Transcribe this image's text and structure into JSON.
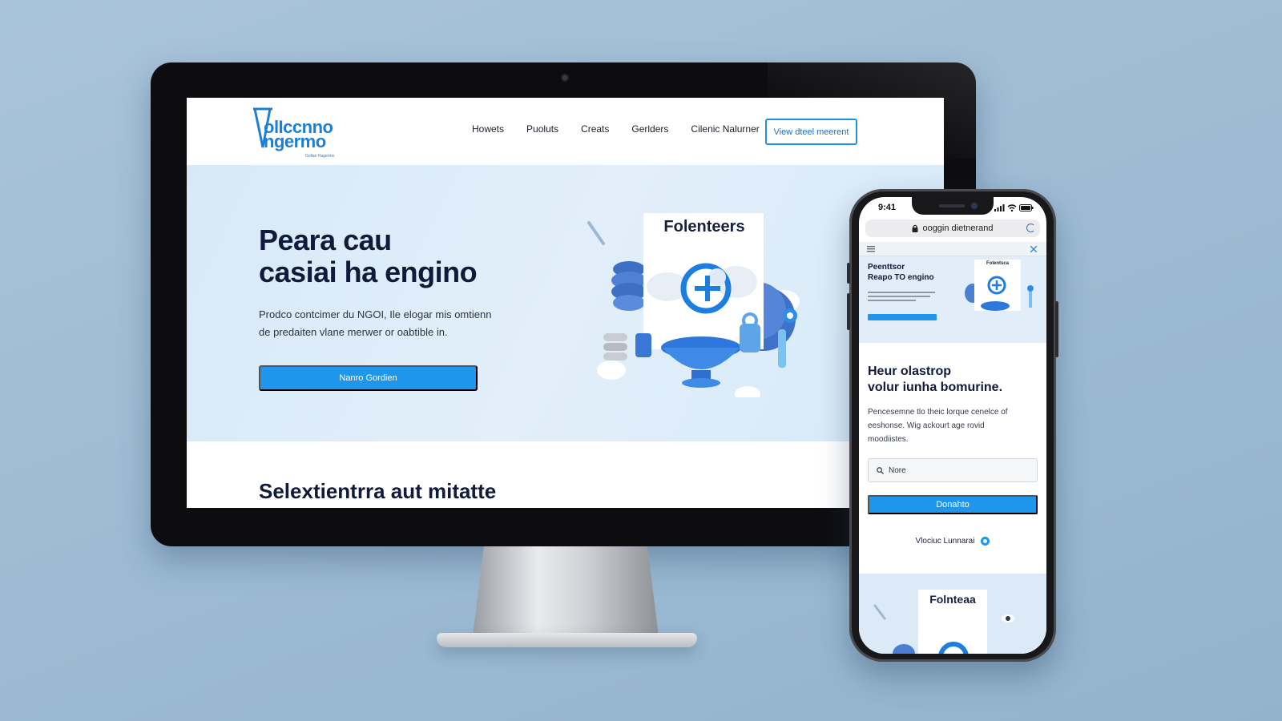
{
  "desktop": {
    "logo": {
      "line1": "olIccnno",
      "line2": "ngermo",
      "tagline": "Gollan Hagermo"
    },
    "nav": {
      "items": [
        "Howets",
        "Puoluts",
        "Creats",
        "Gerlders",
        "Cilenic Nalurner"
      ],
      "cta_label": "View dteel meerent"
    },
    "hero": {
      "title_line1": "Peara cau",
      "title_line2": "casiai ha engino",
      "body_line1": "Prodco contcimer du NGOI, Ile elogar mis omtienn",
      "body_line2": "de predaiten vlane merwer or oabtible in.",
      "button_label": "Nanro Gordien",
      "illustration_title": "Folenteers"
    },
    "section_title": "Selextientrra aut mitatte"
  },
  "phone": {
    "status": {
      "time": "9:41"
    },
    "url": "ooggin dietnerand",
    "preview": {
      "title_line1": "Peenttsor",
      "title_line2": "Reapo TO engino",
      "card_title": "Folentsca"
    },
    "heading_line1": "Heur olastrop",
    "heading_line2": "volur iunha bomurine.",
    "body_line1": "Pencesemne tlo theic lorque cenelce of",
    "body_line2": "eeshonse. Wig ackourt age rovid",
    "body_line3": "moodiistes.",
    "input_value": "Nore",
    "button_label": "Donahto",
    "link_label": "Vlociuc Lunnarai",
    "bottom_title": "Folnteaa"
  },
  "colors": {
    "accent": "#1f96ec",
    "heading": "#101a3a",
    "hero_bg": "#d7e9f7",
    "backdrop": "#a9c4da"
  },
  "icons": {
    "logo": "v-funnel-logo-icon",
    "lock": "lock-icon",
    "reload": "reload-icon",
    "search": "search-icon",
    "signal": "signal-icon",
    "wifi": "wifi-icon",
    "battery": "battery-icon",
    "close": "close-icon"
  }
}
